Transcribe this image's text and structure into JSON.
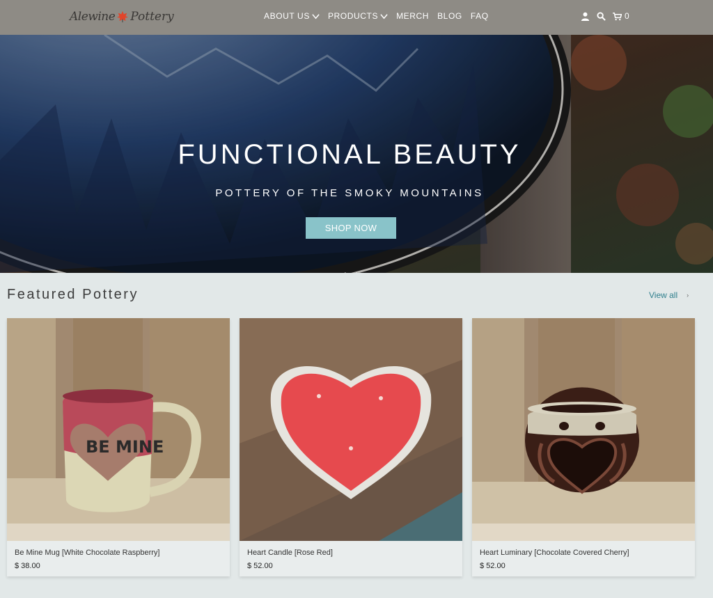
{
  "header": {
    "logo_text_1": "Alewine",
    "logo_text_2": "Pottery",
    "nav": [
      {
        "label": "ABOUT US",
        "has_dropdown": true
      },
      {
        "label": "PRODUCTS",
        "has_dropdown": true
      },
      {
        "label": "MERCH",
        "has_dropdown": false
      },
      {
        "label": "BLOG",
        "has_dropdown": false
      },
      {
        "label": "FAQ",
        "has_dropdown": false
      }
    ],
    "icons": [
      "account-icon",
      "search-icon",
      "cart-icon"
    ],
    "cart_count": "0"
  },
  "hero": {
    "title": "FUNCTIONAL BEAUTY",
    "subtitle": "POTTERY OF THE SMOKY MOUNTAINS",
    "button_label": "SHOP NOW"
  },
  "featured": {
    "title": "Featured Pottery",
    "view_all_label": "View all",
    "products": [
      {
        "name": "Be Mine Mug [White Chocolate Raspberry]",
        "price": "$ 38.00",
        "image_text": "BE MINE"
      },
      {
        "name": "Heart Candle [Rose Red]",
        "price": "$ 52.00"
      },
      {
        "name": "Heart Luminary [Chocolate Covered Cherry]",
        "price": "$ 52.00"
      }
    ]
  },
  "colors": {
    "header_bg": "#8e8b85",
    "page_bg": "#e2e8e8",
    "accent": "#89c3c9",
    "link": "#2f7f8d"
  }
}
